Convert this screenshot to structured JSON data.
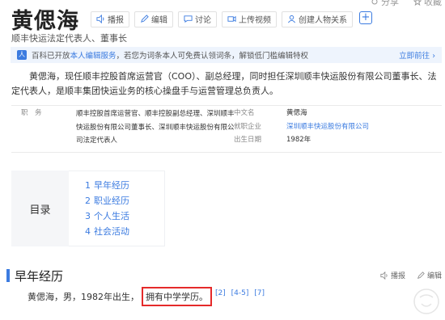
{
  "top_right": {
    "item1": "分享",
    "item2": "收藏"
  },
  "header": {
    "title": "黄偲海",
    "subtitle": "顺丰快运法定代表人、董事长",
    "actions": {
      "play": "播报",
      "edit": "编辑",
      "discuss": "讨论",
      "upload": "上传视频",
      "relation": "创建人物关系"
    }
  },
  "notice": {
    "prefix": "百科已开放",
    "link": "本人编辑服务",
    "suffix": "，若您为词条本人可免费认领词条，解锁低门槛编辑特权",
    "more": "立即前往 ›"
  },
  "summary": "黄偲海，现任顺丰控股首席运营官（COO）、副总经理，同时担任深圳顺丰快运股份有限公司董事长、法定代表人，是顺丰集团快运业务的核心操盘手与运营管理总负责人。",
  "info": {
    "position_label": "职　务",
    "position_lines": [
      "顺丰控股首席运营官、顺丰控股副总经理、深圳顺丰",
      "快运股份有限公司董事长、深圳顺丰快运股份有限公",
      "司法定代表人"
    ],
    "cn_name_label": "中文名",
    "cn_name": "黄偲海",
    "company_label": "就职企业",
    "company": "深圳顺丰快运股份有限公司",
    "birth_label": "出生日期",
    "birth": "1982年"
  },
  "toc": {
    "title": "目录",
    "items": [
      {
        "num": "1",
        "label": "早年经历"
      },
      {
        "num": "2",
        "label": "职业经历"
      },
      {
        "num": "3",
        "label": "个人生活"
      },
      {
        "num": "4",
        "label": "社会活动"
      }
    ]
  },
  "section": {
    "title": "早年经历",
    "play": "播报",
    "edit": "编辑",
    "text_before": "黄偲海，男，1982年出生，",
    "highlight": "拥有中学学历。",
    "refs": [
      "[2]",
      "[4-5]",
      "[7]"
    ]
  }
}
